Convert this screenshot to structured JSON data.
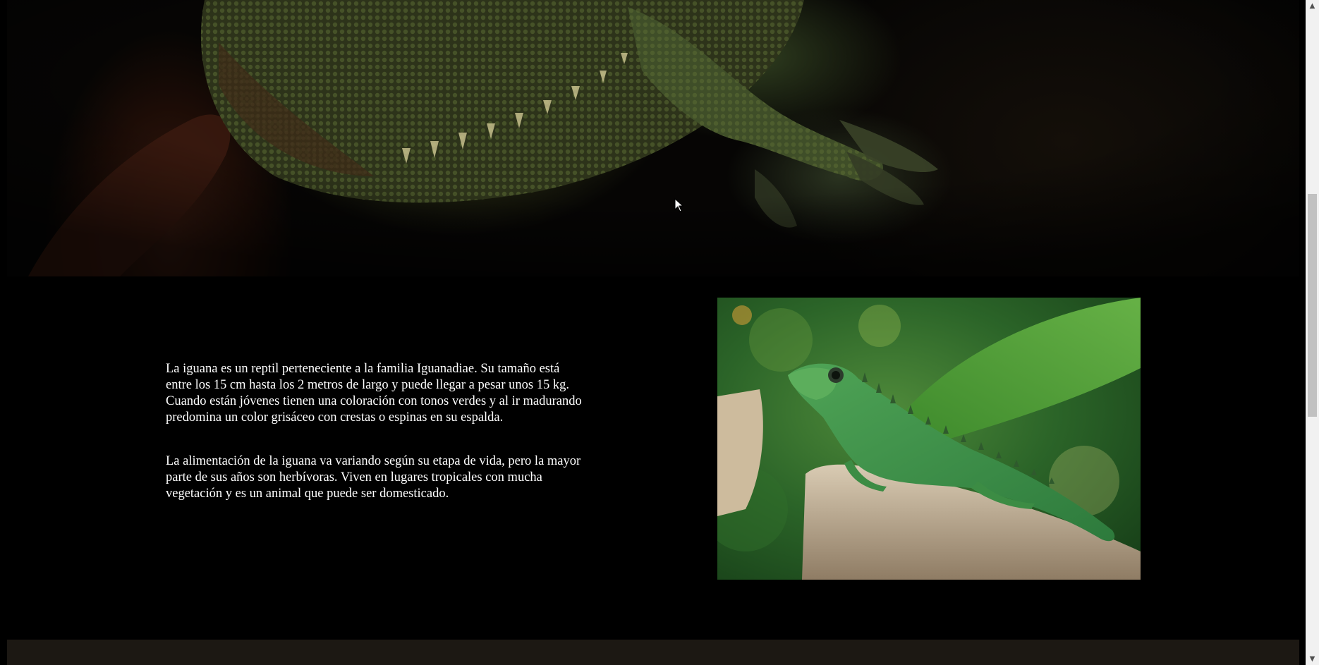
{
  "hero": {
    "image": "iguana-closeup-photo"
  },
  "intro": {
    "paragraph_1": "La iguana es un reptil perteneciente a la familia Iguanadiae. Su tamaño está entre los 15 cm hasta los 2 metros de largo y puede llegar a pesar unos 15 kg. Cuando están jóvenes tienen una coloración con tonos verdes y al ir madurando predomina un color grisáceo con crestas o espinas en su espalda.",
    "paragraph_2": "La alimentación de la iguana va variando según su etapa de vida, pero la mayor parte de sus años son herbívoras. Viven en lugares tropicales con mucha vegetación y es un animal que puede ser domesticado."
  },
  "photo": {
    "image": "green-iguana-on-stump-photo"
  },
  "scrollbar": {
    "up_icon": "chevron-up-icon",
    "down_icon": "chevron-down-icon"
  },
  "colors": {
    "background": "#000000",
    "text": "#ffffff",
    "footer": "#1c1813"
  }
}
